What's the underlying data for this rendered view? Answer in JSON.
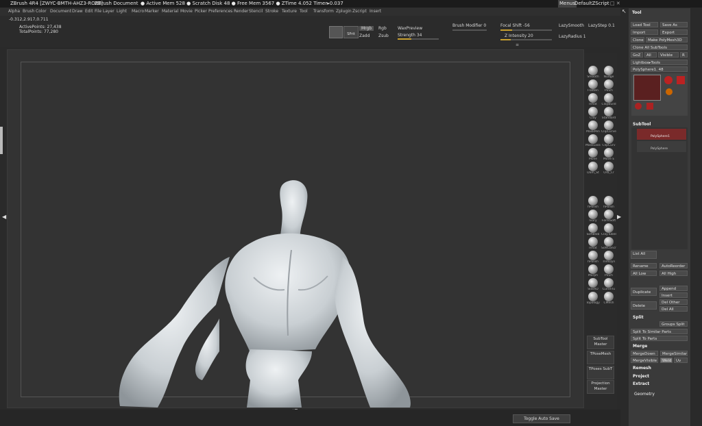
{
  "title": {
    "app": "ZBrush 4R4 [ZWYC-BMTH-AHZ3-RORT]",
    "document": "ZBrush Document",
    "stats": "● Active Mem 528 ● Scratch Disk 48 ● Free Mem 3567 ● ZTime 4.052 Timer▸0.037",
    "menus_btn": "Menus",
    "script": "DefaultZScript"
  },
  "menu": [
    "Alpha",
    "Brush",
    "Color",
    "Document",
    "Draw",
    "Edit",
    "File",
    "Layer",
    "Light",
    "Macro",
    "Marker",
    "Material",
    "Movie",
    "Picker",
    "Preferences",
    "Render",
    "Stencil",
    "Stroke",
    "Texture",
    "Tool",
    "Transform",
    "Zplugin",
    "Zscript",
    "Insert"
  ],
  "info": {
    "coords": "-0.312,2.917,0.711",
    "active_points": "ActivePoints: 27,438",
    "total_points": "TotalPoints: 77,280"
  },
  "toolbar": {
    "sprt": "SPrit",
    "mrgb": "Mrgb",
    "rgb": "Rgb",
    "zadd": "Zadd",
    "zsub": "Zsub",
    "wax": "WaxPreview",
    "strength_label": "Strength 34",
    "brush_mod": "Brush Modifier 0",
    "focal": "Focal Shift -56",
    "zint": "Z Intensity 20",
    "lazysmooth": "LazySmooth",
    "lazystep": "LazyStep 0.1",
    "lazyradius": "LazyRadius 1",
    "strength_fill": 0.34,
    "focal_fill": 0.22,
    "zint_fill": 0.2
  },
  "brushes": [
    {
      "label": "Smooth"
    },
    {
      "label": "Nudge"
    },
    {
      "label": "Flatten"
    },
    {
      "label": "Pinch"
    },
    {
      "label": "Inflat"
    },
    {
      "label": "ClayBuild"
    },
    {
      "label": "Clay"
    },
    {
      "label": "Standard"
    },
    {
      "label": "MaskPen"
    },
    {
      "label": "ClipCurve"
    },
    {
      "label": "MaskLasso"
    },
    {
      "label": "ClipCurv"
    },
    {
      "label": "Move"
    },
    {
      "label": "Move E"
    },
    {
      "label": "Dam_St"
    },
    {
      "label": "Orb_Cr"
    },
    {
      "label": "hPolish"
    },
    {
      "label": "hPolish"
    },
    {
      "label": "Ivory"
    },
    {
      "label": "FormSoft"
    },
    {
      "label": "SoftBlob"
    },
    {
      "label": "ClayTubes"
    },
    {
      "label": "Inflat"
    },
    {
      "label": "SoftConcr"
    },
    {
      "label": "hPolish"
    },
    {
      "label": "TrimDyn"
    },
    {
      "label": "Morph"
    },
    {
      "label": "Pinch"
    },
    {
      "label": "SlashD"
    },
    {
      "label": "CurveTu"
    },
    {
      "label": "Topology"
    },
    {
      "label": "CMesh"
    }
  ],
  "shelf_buttons": [
    {
      "l1": "SubTool",
      "l2": "Master"
    },
    {
      "l1": "TPoseMesh",
      "l2": ""
    },
    {
      "l1": "TPoses SubT",
      "l2": ""
    },
    {
      "l1": "Projection",
      "l2": "Master"
    }
  ],
  "panel": {
    "header": "Tool",
    "load": "Load Tool",
    "saveas": "Save As",
    "import": "Import",
    "export": "Export",
    "clone": "Clone",
    "make_poly": "Make PolyMesh3D",
    "clone_all": "Clone All SubTools",
    "goz": "GoZ",
    "all": "All",
    "visible": "Visible",
    "r": "R",
    "lightbox": "Lightbox▸Tools",
    "tool_name": "PolySphere1. 48",
    "subtool_header": "SubTool",
    "subtool1": "PolySphere1",
    "subtool2": "PolySphere",
    "list_all": "List All",
    "rename": "Rename",
    "autoreorder": "AutoReorder",
    "all_low": "All Low",
    "all_high": "All High",
    "duplicate": "Duplicate",
    "append": "Append",
    "insert": "Insert",
    "delete": "Delete",
    "del_other": "Del Other",
    "del_all": "Del All",
    "split": "Split",
    "groups_split": "Groups Split",
    "split_similar": "Split To Similar Parts",
    "split_parts": "Split To Parts",
    "merge": "Merge",
    "mergedown": "MergeDown",
    "mergesimilar": "MergeSimilar",
    "mergevisible": "MergeVisible",
    "weld": "Weld",
    "uv": "Uv",
    "remesh": "Remesh",
    "project": "Project",
    "extract": "Extract",
    "geometry": "Geometry"
  },
  "status": {
    "autosave": "Toggle Auto Save"
  },
  "colors": {
    "accent": "#c8a030",
    "mesh": "#d8dde0",
    "brand_red": "#a02020"
  }
}
